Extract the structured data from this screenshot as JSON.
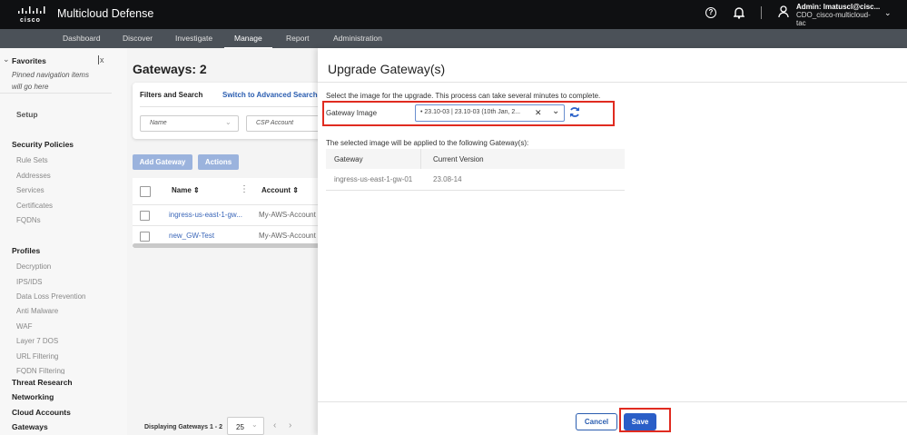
{
  "header": {
    "brand": "cisco",
    "app_title": "Multicloud Defense",
    "user_line1": "Admin: lmatuscl@cisc...",
    "user_line2": "CDO_cisco-multicloud-",
    "user_line3": "tac"
  },
  "nav": [
    "Dashboard",
    "Discover",
    "Investigate",
    "Manage",
    "Report",
    "Administration"
  ],
  "sidebar": {
    "favorites": "Favorites",
    "pinned_hint1": "Pinned navigation items",
    "pinned_hint2": "will go here",
    "setup": "Setup",
    "security_policies": "Security Policies",
    "sp_items": [
      "Rule Sets",
      "Addresses",
      "Services",
      "Certificates",
      "FQDNs"
    ],
    "profiles": "Profiles",
    "profile_items": [
      "Decryption",
      "IPS/IDS",
      "Data Loss Prevention",
      "Anti Malware",
      "WAF",
      "Layer 7 DOS",
      "URL Filtering",
      "FQDN Filtering"
    ],
    "bottom": [
      "Threat Research",
      "Networking",
      "Cloud Accounts",
      "Gateways"
    ]
  },
  "main": {
    "title": "Gateways: 2",
    "filters_label": "Filters and Search",
    "advanced_link": "Switch to Advanced Search",
    "name_placeholder": "Name",
    "csp_placeholder": "CSP Account",
    "add_gateway": "Add Gateway",
    "actions": "Actions",
    "columns": [
      "Name",
      "Account"
    ],
    "rows": [
      {
        "name": "ingress-us-east-1-gw...",
        "account": "My-AWS-Account"
      },
      {
        "name": "new_GW-Test",
        "account": "My-AWS-Account"
      }
    ],
    "displaying": "Displaying Gateways 1 - 2",
    "page_size": "25"
  },
  "panel": {
    "title": "Upgrade Gateway(s)",
    "instruction": "Select the image for the upgrade. This process can take several minutes to complete.",
    "image_label": "Gateway Image",
    "image_value": "23.10-03 | 23.10-03 (10th Jan, 2...",
    "applied_text": "The selected image will be applied to the following Gateway(s):",
    "columns": [
      "Gateway",
      "Current Version"
    ],
    "rows": [
      {
        "gateway": "ingress-us-east-1-gw-01",
        "version": "23.08-14"
      }
    ],
    "cancel": "Cancel",
    "save": "Save"
  }
}
